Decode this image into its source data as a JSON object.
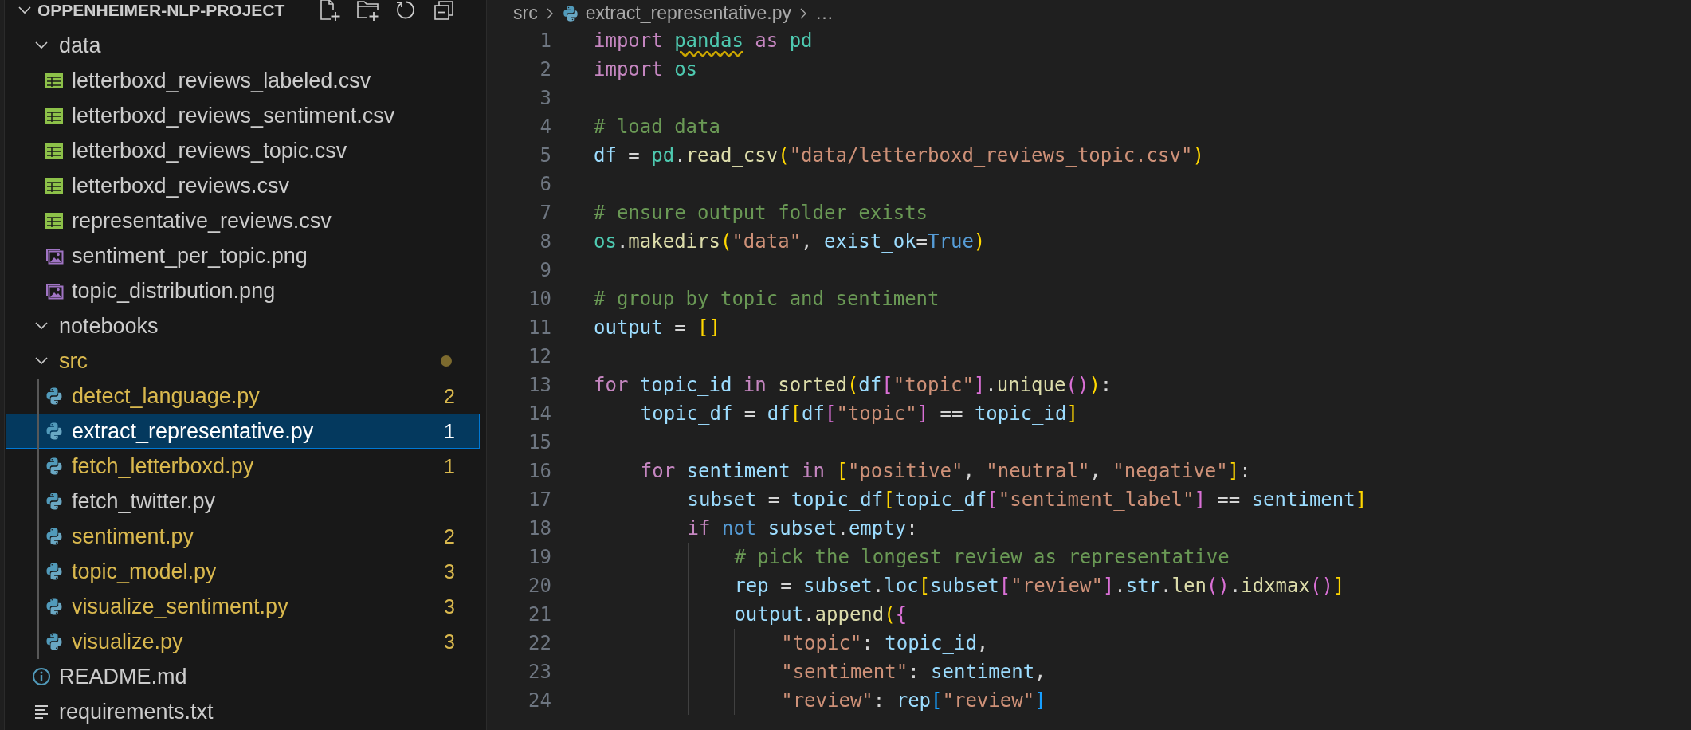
{
  "explorer": {
    "title": "OPPENHEIMER-NLP-PROJECT",
    "expanded": true,
    "items": [
      {
        "name": "data",
        "kind": "folder",
        "expanded": true,
        "selected": false,
        "modified": false,
        "children": [
          {
            "name": "letterboxd_reviews_labeled.csv",
            "kind": "csv",
            "selected": false,
            "modified": false
          },
          {
            "name": "letterboxd_reviews_sentiment.csv",
            "kind": "csv",
            "selected": false,
            "modified": false
          },
          {
            "name": "letterboxd_reviews_topic.csv",
            "kind": "csv",
            "selected": false,
            "modified": false
          },
          {
            "name": "letterboxd_reviews.csv",
            "kind": "csv",
            "selected": false,
            "modified": false
          },
          {
            "name": "representative_reviews.csv",
            "kind": "csv",
            "selected": false,
            "modified": false
          },
          {
            "name": "sentiment_per_topic.png",
            "kind": "image",
            "selected": false,
            "modified": false
          },
          {
            "name": "topic_distribution.png",
            "kind": "image",
            "selected": false,
            "modified": false
          }
        ]
      },
      {
        "name": "notebooks",
        "kind": "folder",
        "expanded": true,
        "selected": false,
        "modified": false
      },
      {
        "name": "src",
        "kind": "folder",
        "expanded": true,
        "selected": false,
        "modified": true,
        "children": [
          {
            "name": "detect_language.py",
            "kind": "python",
            "selected": false,
            "modified": true,
            "badge": "2"
          },
          {
            "name": "extract_representative.py",
            "kind": "python",
            "selected": true,
            "modified": true,
            "badge": "1"
          },
          {
            "name": "fetch_letterboxd.py",
            "kind": "python",
            "selected": false,
            "modified": true,
            "badge": "1"
          },
          {
            "name": "fetch_twitter.py",
            "kind": "python",
            "selected": false,
            "modified": false
          },
          {
            "name": "sentiment.py",
            "kind": "python",
            "selected": false,
            "modified": true,
            "badge": "2"
          },
          {
            "name": "topic_model.py",
            "kind": "python",
            "selected": false,
            "modified": true,
            "badge": "3"
          },
          {
            "name": "visualize_sentiment.py",
            "kind": "python",
            "selected": false,
            "modified": true,
            "badge": "3"
          },
          {
            "name": "visualize.py",
            "kind": "python",
            "selected": false,
            "modified": true,
            "badge": "3"
          }
        ]
      },
      {
        "name": "README.md",
        "kind": "info",
        "selected": false,
        "modified": false
      },
      {
        "name": "requirements.txt",
        "kind": "text",
        "selected": false,
        "modified": false
      }
    ]
  },
  "breadcrumb": [
    {
      "label": "src",
      "kind": "folder"
    },
    {
      "label": "extract_representative.py",
      "kind": "python"
    },
    {
      "label": "…",
      "kind": "more"
    }
  ],
  "code": {
    "lines": [
      {
        "number": "1",
        "tokens": [
          {
            "kind": "kw",
            "t": "import "
          },
          {
            "kind": "mod",
            "t": "pandas",
            "warning": true
          },
          {
            "kind": "kw",
            "t": " as "
          },
          {
            "kind": "mod",
            "t": "pd"
          }
        ]
      },
      {
        "number": "2",
        "tokens": [
          {
            "kind": "kw",
            "t": "import "
          },
          {
            "kind": "mod",
            "t": "os"
          }
        ]
      },
      {
        "number": "3"
      },
      {
        "number": "4",
        "tokens": [
          {
            "kind": "cmt",
            "t": "# load data"
          }
        ]
      },
      {
        "number": "5",
        "tokens": [
          {
            "kind": "var",
            "t": "df"
          },
          {
            "kind": "op",
            "t": " = "
          },
          {
            "kind": "mod",
            "t": "pd"
          },
          {
            "kind": "op",
            "t": "."
          },
          {
            "kind": "fn",
            "t": "read_csv"
          },
          {
            "kind": "b1",
            "t": "("
          },
          {
            "kind": "str",
            "t": "\"data/letterboxd_reviews_topic.csv\""
          },
          {
            "kind": "b1",
            "t": ")"
          }
        ]
      },
      {
        "number": "6"
      },
      {
        "number": "7",
        "tokens": [
          {
            "kind": "cmt",
            "t": "# ensure output folder exists"
          }
        ]
      },
      {
        "number": "8",
        "tokens": [
          {
            "kind": "mod",
            "t": "os"
          },
          {
            "kind": "op",
            "t": "."
          },
          {
            "kind": "fn",
            "t": "makedirs"
          },
          {
            "kind": "b1",
            "t": "("
          },
          {
            "kind": "str",
            "t": "\"data\""
          },
          {
            "kind": "op",
            "t": ", "
          },
          {
            "kind": "var",
            "t": "exist_ok"
          },
          {
            "kind": "op",
            "t": "="
          },
          {
            "kind": "const",
            "t": "True"
          },
          {
            "kind": "b1",
            "t": ")"
          }
        ]
      },
      {
        "number": "9"
      },
      {
        "number": "10",
        "tokens": [
          {
            "kind": "cmt",
            "t": "# group by topic and sentiment"
          }
        ]
      },
      {
        "number": "11",
        "tokens": [
          {
            "kind": "var",
            "t": "output"
          },
          {
            "kind": "op",
            "t": " = "
          },
          {
            "kind": "b1",
            "t": "[]"
          }
        ]
      },
      {
        "number": "12"
      },
      {
        "number": "13",
        "tokens": [
          {
            "kind": "kw",
            "t": "for "
          },
          {
            "kind": "var",
            "t": "topic_id"
          },
          {
            "kind": "kw",
            "t": " in "
          },
          {
            "kind": "fn",
            "t": "sorted"
          },
          {
            "kind": "b1",
            "t": "("
          },
          {
            "kind": "var",
            "t": "df"
          },
          {
            "kind": "b2",
            "t": "["
          },
          {
            "kind": "str",
            "t": "\"topic\""
          },
          {
            "kind": "b2",
            "t": "]"
          },
          {
            "kind": "op",
            "t": "."
          },
          {
            "kind": "fn",
            "t": "unique"
          },
          {
            "kind": "b2",
            "t": "()"
          },
          {
            "kind": "b1",
            "t": ")"
          },
          {
            "kind": "op",
            "t": ":"
          }
        ]
      },
      {
        "number": "14",
        "tokens": [
          {
            "kind": "var",
            "t": "    topic_df"
          },
          {
            "kind": "op",
            "t": " = "
          },
          {
            "kind": "var",
            "t": "df"
          },
          {
            "kind": "b1",
            "t": "["
          },
          {
            "kind": "var",
            "t": "df"
          },
          {
            "kind": "b2",
            "t": "["
          },
          {
            "kind": "str",
            "t": "\"topic\""
          },
          {
            "kind": "b2",
            "t": "]"
          },
          {
            "kind": "op",
            "t": " == "
          },
          {
            "kind": "var",
            "t": "topic_id"
          },
          {
            "kind": "b1",
            "t": "]"
          }
        ]
      },
      {
        "number": "15"
      },
      {
        "number": "16",
        "tokens": [
          {
            "kind": "kw",
            "t": "    for "
          },
          {
            "kind": "var",
            "t": "sentiment"
          },
          {
            "kind": "kw",
            "t": " in "
          },
          {
            "kind": "b1",
            "t": "["
          },
          {
            "kind": "str",
            "t": "\"positive\""
          },
          {
            "kind": "op",
            "t": ", "
          },
          {
            "kind": "str",
            "t": "\"neutral\""
          },
          {
            "kind": "op",
            "t": ", "
          },
          {
            "kind": "str",
            "t": "\"negative\""
          },
          {
            "kind": "b1",
            "t": "]"
          },
          {
            "kind": "op",
            "t": ":"
          }
        ]
      },
      {
        "number": "17",
        "tokens": [
          {
            "kind": "var",
            "t": "        subset"
          },
          {
            "kind": "op",
            "t": " = "
          },
          {
            "kind": "var",
            "t": "topic_df"
          },
          {
            "kind": "b1",
            "t": "["
          },
          {
            "kind": "var",
            "t": "topic_df"
          },
          {
            "kind": "b2",
            "t": "["
          },
          {
            "kind": "str",
            "t": "\"sentiment_label\""
          },
          {
            "kind": "b2",
            "t": "]"
          },
          {
            "kind": "op",
            "t": " == "
          },
          {
            "kind": "var",
            "t": "sentiment"
          },
          {
            "kind": "b1",
            "t": "]"
          }
        ]
      },
      {
        "number": "18",
        "tokens": [
          {
            "kind": "kw",
            "t": "        if "
          },
          {
            "kind": "kw2",
            "t": "not "
          },
          {
            "kind": "var",
            "t": "subset"
          },
          {
            "kind": "op",
            "t": "."
          },
          {
            "kind": "var",
            "t": "empty"
          },
          {
            "kind": "op",
            "t": ":"
          }
        ]
      },
      {
        "number": "19",
        "tokens": [
          {
            "kind": "cmt",
            "t": "            # pick the longest review as representative"
          }
        ]
      },
      {
        "number": "20",
        "tokens": [
          {
            "kind": "var",
            "t": "            rep"
          },
          {
            "kind": "op",
            "t": " = "
          },
          {
            "kind": "var",
            "t": "subset"
          },
          {
            "kind": "op",
            "t": "."
          },
          {
            "kind": "var",
            "t": "loc"
          },
          {
            "kind": "b1",
            "t": "["
          },
          {
            "kind": "var",
            "t": "subset"
          },
          {
            "kind": "b2",
            "t": "["
          },
          {
            "kind": "str",
            "t": "\"review\""
          },
          {
            "kind": "b2",
            "t": "]"
          },
          {
            "kind": "op",
            "t": "."
          },
          {
            "kind": "var",
            "t": "str"
          },
          {
            "kind": "op",
            "t": "."
          },
          {
            "kind": "fn",
            "t": "len"
          },
          {
            "kind": "b2",
            "t": "()"
          },
          {
            "kind": "op",
            "t": "."
          },
          {
            "kind": "fn",
            "t": "idxmax"
          },
          {
            "kind": "b2",
            "t": "()"
          },
          {
            "kind": "b1",
            "t": "]"
          }
        ]
      },
      {
        "number": "21",
        "tokens": [
          {
            "kind": "var",
            "t": "            output"
          },
          {
            "kind": "op",
            "t": "."
          },
          {
            "kind": "fn",
            "t": "append"
          },
          {
            "kind": "b1",
            "t": "("
          },
          {
            "kind": "b2",
            "t": "{"
          }
        ]
      },
      {
        "number": "22",
        "tokens": [
          {
            "kind": "str",
            "t": "                \"topic\""
          },
          {
            "kind": "op",
            "t": ": "
          },
          {
            "kind": "var",
            "t": "topic_id"
          },
          {
            "kind": "op",
            "t": ","
          }
        ]
      },
      {
        "number": "23",
        "tokens": [
          {
            "kind": "str",
            "t": "                \"sentiment\""
          },
          {
            "kind": "op",
            "t": ": "
          },
          {
            "kind": "var",
            "t": "sentiment"
          },
          {
            "kind": "op",
            "t": ","
          }
        ]
      },
      {
        "number": "24",
        "tokens": [
          {
            "kind": "str",
            "t": "                \"review\""
          },
          {
            "kind": "op",
            "t": ": "
          },
          {
            "kind": "var",
            "t": "rep"
          },
          {
            "kind": "b3",
            "t": "["
          },
          {
            "kind": "str",
            "t": "\"review\""
          },
          {
            "kind": "b3",
            "t": "]"
          }
        ]
      }
    ]
  }
}
